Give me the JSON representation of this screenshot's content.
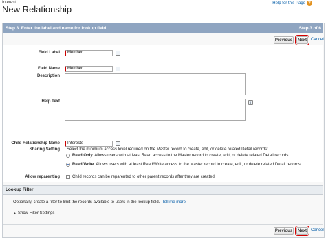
{
  "header": {
    "object_label": "Interest",
    "title": "New Relationship",
    "help_link": "Help for this Page",
    "help_icon": "question-mark-icon"
  },
  "step": {
    "title": "Step 3. Enter the label and name for lookup field",
    "count": "Step 3 of 6"
  },
  "buttons": {
    "previous": "Previous",
    "next": "Next",
    "cancel": "Cancel"
  },
  "form": {
    "field_label": {
      "label": "Field Label",
      "value": "Member"
    },
    "field_name": {
      "label": "Field Name",
      "value": "Member"
    },
    "description": {
      "label": "Description"
    },
    "help_text": {
      "label": "Help Text"
    },
    "child_relationship_name": {
      "label": "Child Relationship Name",
      "value": "Interests"
    },
    "sharing_setting": {
      "label": "Sharing Setting",
      "intro": "Select the minimum access level required on the Master record to create, edit, or delete related Detail records:",
      "options": [
        {
          "title": "Read Only.",
          "text": " Allows users with at least Read access to the Master record to create, edit, or delete related Detail records.",
          "selected": false
        },
        {
          "title": "Read/Write.",
          "text": " Allows users with at least Read/Write access to the Master record to create, edit, or delete related Detail records.",
          "selected": true
        }
      ]
    },
    "allow_reparenting": {
      "label": "Allow reparenting",
      "text": "Child records can be reparented to other parent records after they are created",
      "checked": false
    },
    "info_icon": "i"
  },
  "lookup_filter": {
    "title": "Lookup Filter",
    "description": "Optionally, create a filter to limit the records available to users in the lookup field.",
    "tell_me_more": "Tell me more!",
    "show_filter_settings": "Show Filter Settings"
  },
  "colors": {
    "step_bar": "#8fa5c1",
    "highlight": "#d50000",
    "link": "#015ba7",
    "required": "#cc0000"
  }
}
